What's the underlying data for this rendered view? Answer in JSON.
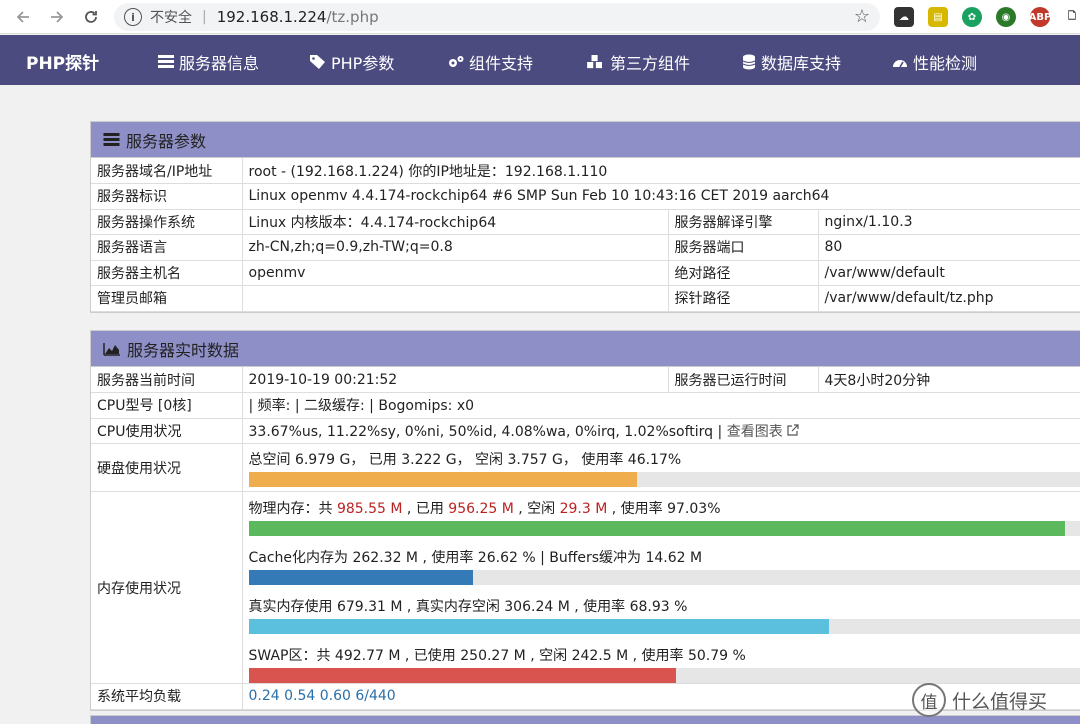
{
  "browser": {
    "insecure_label": "不安全",
    "url_host": "192.168.1.224",
    "url_path": "/tz.php",
    "extensions": [
      {
        "name": "abp",
        "label": "ABP",
        "color": "#c0392b"
      }
    ]
  },
  "nav": {
    "brand": "PHP探针",
    "items": [
      {
        "label": "服务器信息",
        "icon": "server-icon"
      },
      {
        "label": "PHP参数",
        "icon": "tag-icon"
      },
      {
        "label": "组件支持",
        "icon": "cogs-icon"
      },
      {
        "label": "第三方组件",
        "icon": "cubes-icon"
      },
      {
        "label": "数据库支持",
        "icon": "database-icon"
      },
      {
        "label": "性能检测",
        "icon": "dashboard-icon"
      }
    ]
  },
  "server_params": {
    "title": "服务器参数",
    "rows": [
      {
        "label": "服务器域名/IP地址",
        "value": "root - (192.168.1.224)  你的IP地址是：192.168.1.110"
      },
      {
        "label": "服务器标识",
        "value": "Linux openmv 4.4.174-rockchip64 #6 SMP Sun Feb 10 10:43:16 CET 2019 aarch64"
      },
      {
        "label": "服务器操作系统",
        "value": "Linux  内核版本：4.4.174-rockchip64",
        "label2": "服务器解译引擎",
        "value2": "nginx/1.10.3"
      },
      {
        "label": "服务器语言",
        "value": "zh-CN,zh;q=0.9,zh-TW;q=0.8",
        "label2": "服务器端口",
        "value2": "80"
      },
      {
        "label": "服务器主机名",
        "value": "openmv",
        "label2": "绝对路径",
        "value2": "/var/www/default"
      },
      {
        "label": "管理员邮箱",
        "value": "",
        "label2": "探针路径",
        "value2": "/var/www/default/tz.php"
      }
    ]
  },
  "realtime": {
    "title": "服务器实时数据",
    "time_label": "服务器当前时间",
    "time_value": "2019-10-19 00:21:52",
    "uptime_label": "服务器已运行时间",
    "uptime_value": "4天8小时20分钟",
    "cpu_model_label": "CPU型号 [0核]",
    "cpu_model_value": "| 频率: | 二级缓存: | Bogomips: x0",
    "cpu_usage_label": "CPU使用状况",
    "cpu_usage_value": "33.67%us, 11.22%sy, 0%ni, 50%id, 4.08%wa, 0%irq, 1.02%softirq |",
    "cpu_chart_link": "查看图表",
    "disk_label": "硬盘使用状况",
    "disk_text": "总空间 6.979 G，  已用 3.222 G，  空闲 3.757 G，  使用率 46.17%",
    "disk_percent": 46.17,
    "disk_color": "#f0ad4e",
    "mem_label": "内存使用状况",
    "mem": {
      "phys_prefix": "物理内存：共 ",
      "phys_total": "985.55 M",
      "phys_used_label": " , 已用 ",
      "phys_used": "956.25 M",
      "phys_free_label": " , 空闲 ",
      "phys_free": "29.3 M",
      "phys_rate": " , 使用率 97.03%",
      "phys_percent": 97.03,
      "phys_color": "#5cb85c",
      "cache_text": "Cache化内存为 262.32 M , 使用率 26.62 % | Buffers缓冲为 14.62 M",
      "cache_percent": 26.62,
      "cache_color": "#337ab7",
      "real_text": "真实内存使用 679.31 M , 真实内存空闲 306.24 M , 使用率 68.93 %",
      "real_percent": 68.93,
      "real_color": "#5bc0de",
      "swap_text": "SWAP区：共 492.77 M , 已使用 250.27 M , 空闲 242.5 M , 使用率 50.79 %",
      "swap_percent": 50.79,
      "swap_color": "#d9534f"
    },
    "load_label": "系统平均负载",
    "load_value": "0.24 0.54 0.60 6/440"
  },
  "watermark": {
    "icon_char": "值",
    "text": "什么值得买"
  }
}
